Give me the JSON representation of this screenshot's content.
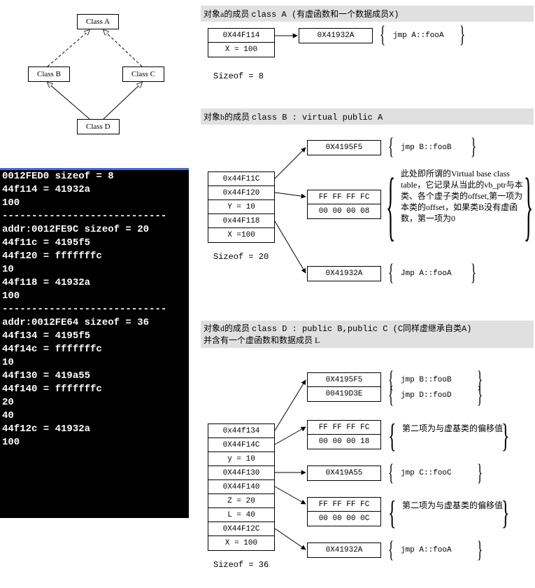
{
  "uml": {
    "class_a": "Class A",
    "class_b": "Class B",
    "class_c": "Class C",
    "class_d": "Class D"
  },
  "console": {
    "lines1": [
      "0012FED0 sizeof = 8",
      "44f114 = 41932a",
      "100"
    ],
    "lines2": [
      "addr:0012FE9C sizeof = 20",
      "44f11c = 4195f5",
      "44f120 = fffffffc",
      "10",
      "44f118 = 41932a",
      "100"
    ],
    "lines3": [
      "addr:0012FE64 sizeof = 36",
      "44f134 = 4195f5",
      "44f14c = fffffffc",
      "10",
      "44f130 = 419a55",
      "44f140 = fffffffc",
      "20",
      "40",
      "44f12c = 41932a",
      "100"
    ]
  },
  "section_a": {
    "header_prefix": "对象a的成员   ",
    "header_code": "class A (有虚函数和一个数据成员X)",
    "cell_vptr": "0X44F114",
    "cell_x": "X = 100",
    "cell_jmptarget": "0X41932A",
    "ann": "jmp A::fooA",
    "sizeof": "Sizeof = 8"
  },
  "section_b": {
    "header_prefix": "对象b的成员   ",
    "header_code": "class B : virtual public A",
    "cells": {
      "c0": "0x44F11C",
      "c1": "0x44F120",
      "c2": "Y = 10",
      "c3": "0x44F118",
      "c4": "X =100"
    },
    "mid_top": "0X4195F5",
    "mid_vbt1": "FF FF FF FC",
    "mid_vbt2": "00 00 00 08",
    "mid_bot": "0X41932A",
    "ann_top": "jmp  B::fooB",
    "ann_vbt": "此处即所谓的Virtual base class table，它记录从当此的vb_ptr与本类、各个虚子类的offset,第一项为本类的offset，如果类B没有虚函数，第一项为0",
    "ann_bot": "Jmp A::fooA",
    "sizeof": "Sizeof = 20"
  },
  "section_d": {
    "header_prefix": "对象d的成员   ",
    "header_code": "class D : public B,public C (C同样虚继承自类A)",
    "header_line2": "并含有一个虚函数和数据成员 L",
    "cells": {
      "c0": "0x44f134",
      "c1": "0X44F14C",
      "c2": "y = 10",
      "c3": "0X44F130",
      "c4": "0X44F140",
      "c5": "Z = 20",
      "c6": "L = 40",
      "c7": "0X44F12C",
      "c8": "X = 100"
    },
    "mid1a": "0X4195F5",
    "mid1b": "00419D3E",
    "mid_vbt1a": "FF FF FF FC",
    "mid_vbt1b": "00 00 00 18",
    "mid3": "0X419A55",
    "mid_vbt2a": "FF FF FF FC",
    "mid_vbt2b": "00 00 00 0C",
    "mid5": "0X41932A",
    "ann1": "jmp  B::fooB",
    "ann2": "jmp  D::fooD",
    "ann3": "第二项为与虚基类的偏移值",
    "ann4": "jmp C::fooC",
    "ann5": "第二项为与虚基类的偏移值",
    "ann6": "jmp A::fooA",
    "sizeof": "Sizeof = 36"
  }
}
